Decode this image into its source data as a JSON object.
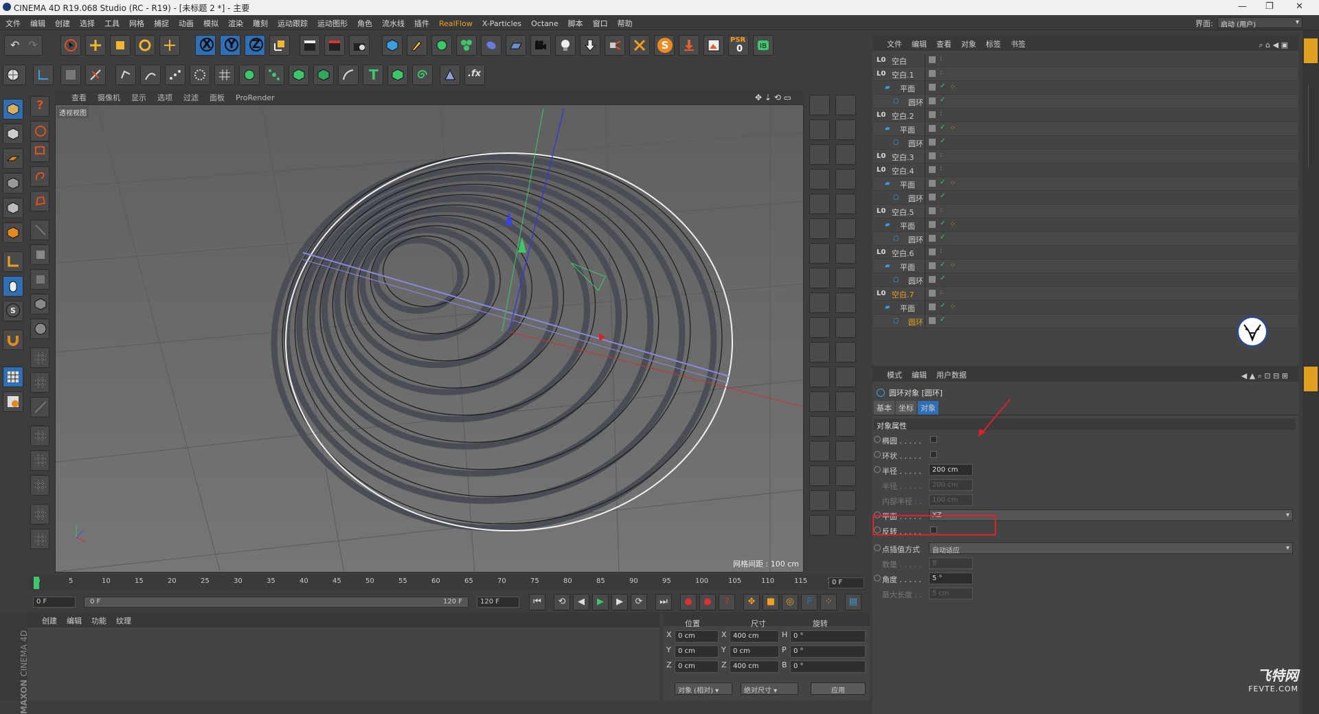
{
  "window": {
    "title": "CINEMA 4D R19.068 Studio (RC - R19) - [未标题 2 *] - 主要",
    "layout_label": "界面:",
    "layout_value": "启动 (用户)"
  },
  "menu": [
    "文件",
    "编辑",
    "创建",
    "选择",
    "工具",
    "网格",
    "捕捉",
    "动画",
    "模拟",
    "渲染",
    "雕刻",
    "运动跟踪",
    "运动图形",
    "角色",
    "流水线",
    "插件",
    "RealFlow",
    "X-Particles",
    "Octane",
    "脚本",
    "窗口",
    "帮助"
  ],
  "viewport": {
    "menu": [
      "查看",
      "摄像机",
      "显示",
      "选项",
      "过滤",
      "面板",
      "ProRender"
    ],
    "label": "透视视图",
    "grid_info": "网格间距 : 100 cm",
    "rings": 9
  },
  "objects": {
    "menu": [
      "文件",
      "编辑",
      "查看",
      "对象",
      "标签",
      "书签"
    ],
    "rows": [
      {
        "name": "空白",
        "level": 0,
        "icon": "null-icon",
        "tag": false
      },
      {
        "name": "空白.1",
        "level": 0,
        "icon": "null-icon",
        "tag": false
      },
      {
        "name": "平面",
        "level": 1,
        "icon": "plane-icon",
        "tag": true
      },
      {
        "name": "圆环",
        "level": 2,
        "icon": "circle-icon",
        "tag": false
      },
      {
        "name": "空白.2",
        "level": 0,
        "icon": "null-icon",
        "tag": false
      },
      {
        "name": "平面",
        "level": 1,
        "icon": "plane-icon",
        "tag": true
      },
      {
        "name": "圆环",
        "level": 2,
        "icon": "circle-icon",
        "tag": false
      },
      {
        "name": "空白.3",
        "level": 0,
        "icon": "null-icon",
        "tag": false
      },
      {
        "name": "空白.4",
        "level": 0,
        "icon": "null-icon",
        "tag": false
      },
      {
        "name": "平面",
        "level": 1,
        "icon": "plane-icon",
        "tag": true
      },
      {
        "name": "圆环",
        "level": 2,
        "icon": "circle-icon",
        "tag": false
      },
      {
        "name": "空白.5",
        "level": 0,
        "icon": "null-icon",
        "tag": false
      },
      {
        "name": "平面",
        "level": 1,
        "icon": "plane-icon",
        "tag": true
      },
      {
        "name": "圆环",
        "level": 2,
        "icon": "circle-icon",
        "tag": false
      },
      {
        "name": "空白.6",
        "level": 0,
        "icon": "null-icon",
        "tag": false
      },
      {
        "name": "平面",
        "level": 1,
        "icon": "plane-icon",
        "tag": true
      },
      {
        "name": "圆环",
        "level": 2,
        "icon": "circle-icon",
        "tag": false
      },
      {
        "name": "空白.7",
        "level": 0,
        "icon": "null-icon",
        "tag": false,
        "highlight": true
      },
      {
        "name": "平面",
        "level": 1,
        "icon": "plane-icon",
        "tag": true
      },
      {
        "name": "圆环",
        "level": 2,
        "icon": "circle-icon",
        "tag": false,
        "highlight": true
      }
    ]
  },
  "attributes": {
    "menu": [
      "模式",
      "编辑",
      "用户数据"
    ],
    "object_title": "圆环对象 [圆环]",
    "tabs": [
      "基本",
      "坐标",
      "对象"
    ],
    "active_tab": "对象",
    "section": "对象属性",
    "fields": [
      {
        "label": "椭圆 . . . . .",
        "type": "checkbox",
        "value": ""
      },
      {
        "label": "环状 . . . . .",
        "type": "checkbox",
        "value": ""
      },
      {
        "label": "半径 . . . . .",
        "type": "number",
        "value": "200 cm",
        "highlight": true
      },
      {
        "label": "半径 . . . . .",
        "type": "number",
        "value": "200 cm",
        "disabled": true
      },
      {
        "label": "内部半径 . .",
        "type": "number",
        "value": "100 cm",
        "disabled": true
      },
      {
        "label": "平面 . . . . .",
        "type": "select",
        "value": "XZ"
      },
      {
        "label": "反转 . . . . .",
        "type": "checkbox",
        "value": ""
      }
    ],
    "interp": {
      "label": "点插值方式",
      "value": "自动适应"
    },
    "extra": [
      {
        "label": "数量 . . . . .",
        "value": "8",
        "disabled": true
      },
      {
        "label": "角度 . . . . .",
        "value": "5 °",
        "disabled": false
      },
      {
        "label": "最大长度 . .",
        "value": "5 cm",
        "disabled": true
      }
    ]
  },
  "timeline": {
    "ticks": [
      "0",
      "5",
      "10",
      "15",
      "20",
      "25",
      "30",
      "35",
      "40",
      "45",
      "50",
      "55",
      "60",
      "65",
      "70",
      "75",
      "80",
      "85",
      "90",
      "95",
      "100",
      "105",
      "110",
      "115",
      "120"
    ],
    "current_frame": "0 F",
    "start": "0 F",
    "range_start": "0 F",
    "range_end": "120 F",
    "end": "120 F"
  },
  "material": {
    "menu": [
      "创建",
      "编辑",
      "功能",
      "纹理"
    ]
  },
  "coords": {
    "headers": [
      "位置",
      "尺寸",
      "旋转"
    ],
    "rows": [
      {
        "axis": "X",
        "pos": "0 cm",
        "size_axis": "X",
        "size": "400 cm",
        "rot_axis": "H",
        "rot": "0 °"
      },
      {
        "axis": "Y",
        "pos": "0 cm",
        "size_axis": "Y",
        "size": "0 cm",
        "rot_axis": "P",
        "rot": "0 °"
      },
      {
        "axis": "Z",
        "pos": "0 cm",
        "size_axis": "Z",
        "size": "400 cm",
        "rot_axis": "B",
        "rot": "0 °"
      }
    ],
    "mode": "对象 (相对)",
    "size_mode": "绝对尺寸",
    "apply": "应用"
  },
  "branding": {
    "maxon": "MAXON",
    "c4d": "CINEMA 4D",
    "watermark": "飞特网",
    "watermark_url": "FEVTE.COM"
  },
  "colors": {
    "accent": "#2f6fb5",
    "highlight_box": "#e0202a",
    "orange": "#e8a020"
  }
}
